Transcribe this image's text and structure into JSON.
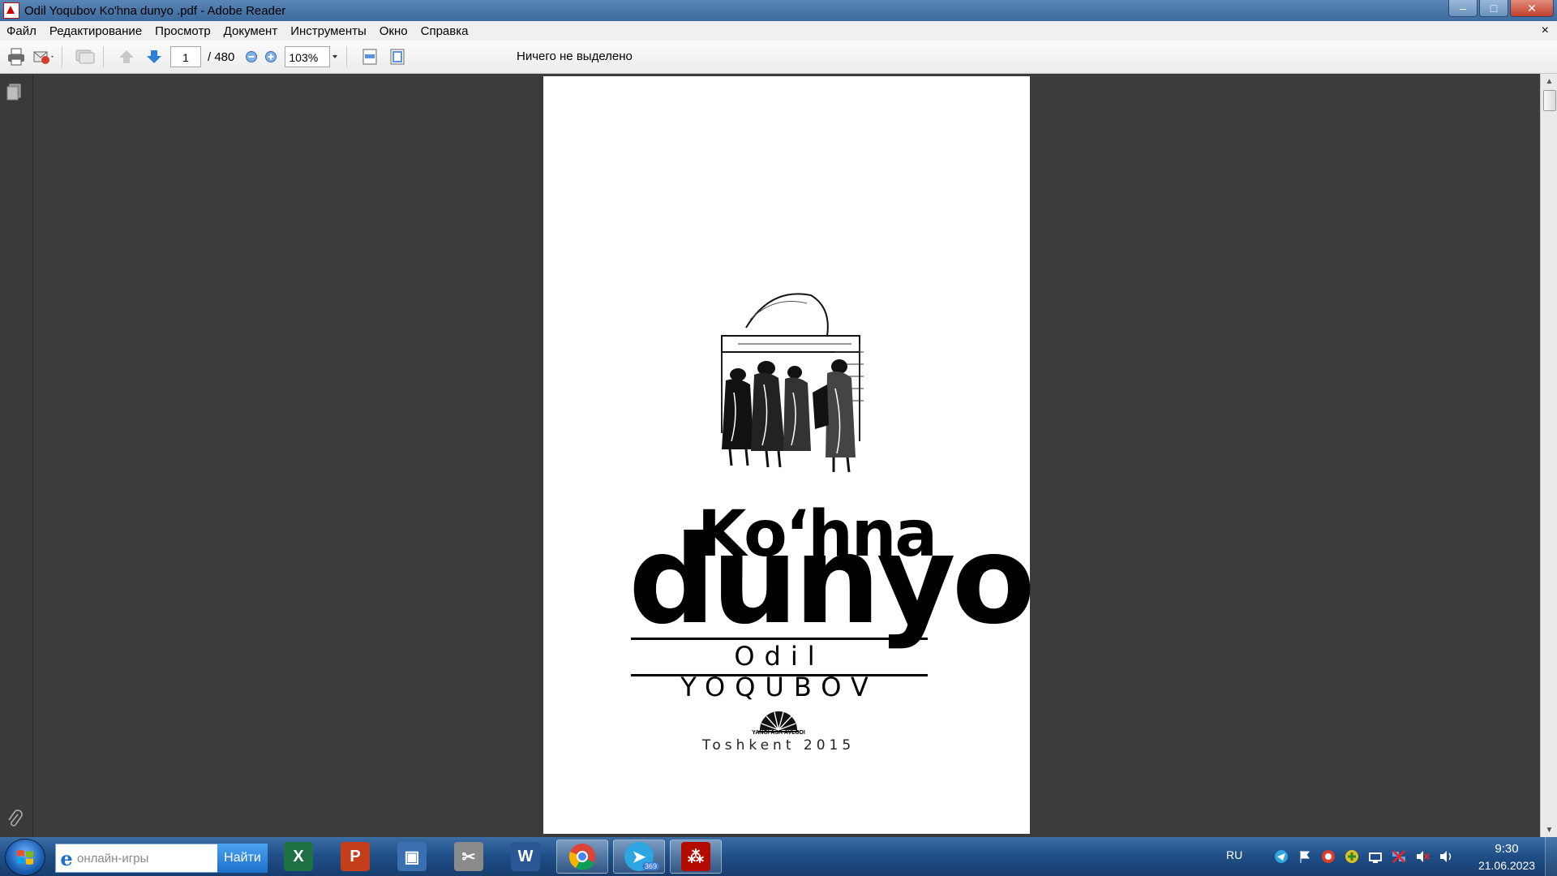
{
  "window": {
    "title": "Odil Yoqubov Ko'hna dunyo .pdf - Adobe Reader",
    "minimize_glyph": "–",
    "maximize_glyph": "□",
    "close_glyph": "✕"
  },
  "menu": {
    "items": [
      "Файл",
      "Редактирование",
      "Просмотр",
      "Документ",
      "Инструменты",
      "Окно",
      "Справка"
    ],
    "close_glyph": "×"
  },
  "toolbar": {
    "current_page": "1",
    "total_pages": "/ 480",
    "zoom": "103%",
    "status": "Ничего не выделено"
  },
  "document": {
    "title_line_1": "Ko‘hna",
    "title_line_2": "dunyo",
    "author": "Odil YOQUBOV",
    "publisher": "YANGI ASR AVLODI",
    "city_year": "Toshkent 2015"
  },
  "taskbar": {
    "search_placeholder": "онлайн-игры",
    "search_button": "Найти",
    "apps": [
      {
        "name": "excel",
        "glyph": "X",
        "color": "#1e7145"
      },
      {
        "name": "powerpoint",
        "glyph": "P",
        "color": "#c43e1c"
      },
      {
        "name": "computer",
        "glyph": "▣",
        "color": "#3a6fb0"
      },
      {
        "name": "snipping-tool",
        "glyph": "✂",
        "color": "#8a8a8a"
      },
      {
        "name": "word",
        "glyph": "W",
        "color": "#2b5797"
      },
      {
        "name": "chrome",
        "glyph": "●",
        "color": "#dd4b39"
      },
      {
        "name": "telegram",
        "glyph": "➤",
        "color": "#2ca5e0",
        "badge": "369"
      },
      {
        "name": "adobe-reader",
        "glyph": "⁂",
        "color": "#b30b00"
      }
    ],
    "language": "RU",
    "time": "9:30",
    "date": "21.06.2023"
  },
  "colors": {
    "accent": "#1f4e86",
    "reader_red": "#b30b00",
    "doc_background": "#3b3b3b"
  }
}
